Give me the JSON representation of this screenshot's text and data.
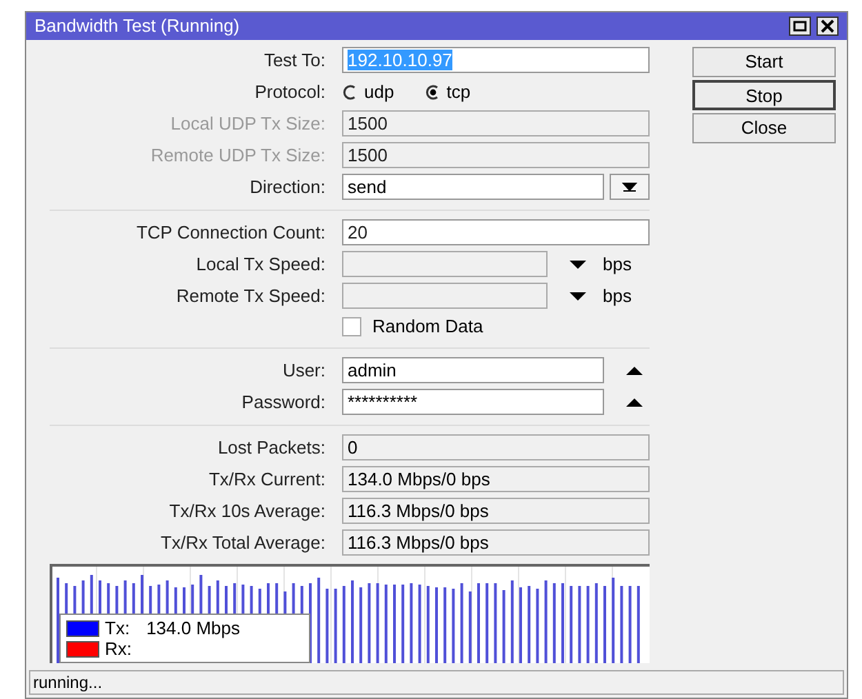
{
  "window": {
    "title": "Bandwidth Test (Running)"
  },
  "buttons": [
    {
      "label": "Start",
      "focused": false
    },
    {
      "label": "Stop",
      "focused": true
    },
    {
      "label": "Close",
      "focused": false
    }
  ],
  "rows": [
    {
      "kind": "text",
      "label": "Test To:",
      "value": "192.10.10.97",
      "disabled": false,
      "text_selected": true
    },
    {
      "kind": "radio",
      "label": "Protocol:",
      "options": [
        {
          "label": "udp",
          "selected": false
        },
        {
          "label": "tcp",
          "selected": true
        }
      ]
    },
    {
      "kind": "text",
      "label": "Local UDP Tx Size:",
      "value": "1500",
      "disabled": true
    },
    {
      "kind": "text",
      "label": "Remote UDP Tx Size:",
      "value": "1500",
      "disabled": true
    },
    {
      "kind": "dropdown",
      "label": "Direction:",
      "value": "send"
    },
    {
      "kind": "separator"
    },
    {
      "kind": "text",
      "label": "TCP Connection Count:",
      "value": "20",
      "disabled": false
    },
    {
      "kind": "speed",
      "label": "Local Tx Speed:",
      "unit": "bps"
    },
    {
      "kind": "speed",
      "label": "Remote Tx Speed:",
      "unit": "bps"
    },
    {
      "kind": "checkbox",
      "label": "Random Data",
      "checked": false
    },
    {
      "kind": "separator"
    },
    {
      "kind": "credential",
      "label": "User:",
      "value": "admin"
    },
    {
      "kind": "credential",
      "label": "Password:",
      "value": "**********"
    },
    {
      "kind": "separator"
    },
    {
      "kind": "readout",
      "label": "Lost Packets:",
      "value": "0"
    },
    {
      "kind": "readout",
      "label": "Tx/Rx Current:",
      "value": "134.0 Mbps/0 bps"
    },
    {
      "kind": "readout",
      "label": "Tx/Rx 10s Average:",
      "value": "116.3 Mbps/0 bps"
    },
    {
      "kind": "readout",
      "label": "Tx/Rx Total Average:",
      "value": "116.3 Mbps/0 bps"
    }
  ],
  "graph": {
    "legend": [
      {
        "label": "Tx:",
        "value": "134.0 Mbps",
        "color": "#0000ff"
      },
      {
        "label": "Rx:",
        "color": "#ff0000"
      }
    ]
  },
  "status_bar": "running..."
}
